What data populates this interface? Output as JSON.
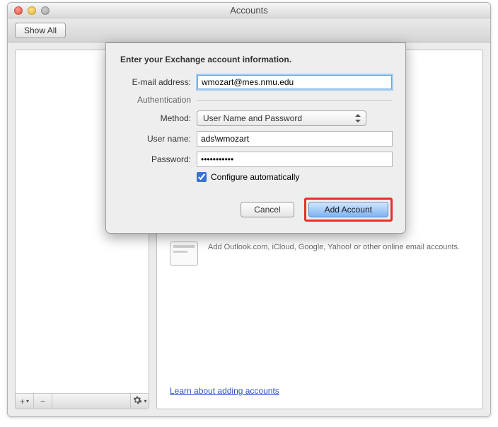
{
  "window": {
    "title": "Accounts",
    "toolbar": {
      "show_all": "Show All"
    }
  },
  "sidebar": {
    "footer": {
      "add_label": "+",
      "add_menu_indicator": "▾",
      "remove_label": "−",
      "gear_menu_indicator": "▾"
    }
  },
  "main": {
    "other_email_desc": "Add Outlook.com, iCloud, Google, Yahoo! or other online email accounts.",
    "learn_link": "Learn about adding accounts"
  },
  "dialog": {
    "heading": "Enter your Exchange account information.",
    "labels": {
      "email": "E-mail address:",
      "authentication": "Authentication",
      "method": "Method:",
      "username": "User name:",
      "password": "Password:",
      "configure_auto": "Configure automatically"
    },
    "values": {
      "email": "wmozart@mes.nmu.edu",
      "method": "User Name and Password",
      "username": "ads\\wmozart",
      "password": "•••••••••••",
      "configure_auto_checked": true
    },
    "buttons": {
      "cancel": "Cancel",
      "submit": "Add Account"
    }
  }
}
